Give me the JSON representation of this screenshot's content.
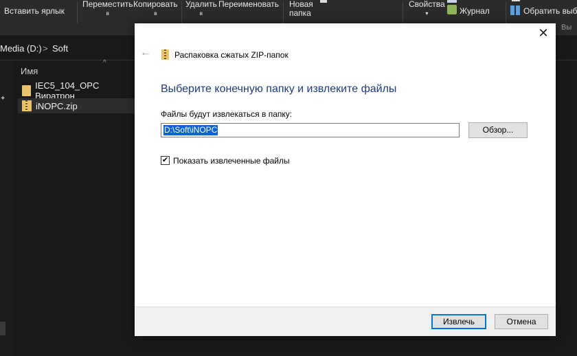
{
  "ribbon": {
    "paste_shortcut": "Вставить ярлык",
    "move_to": "Переместить",
    "copy_to": "Копировать",
    "caret": "в",
    "delete": "Удалить",
    "rename": "Переименовать",
    "new_folder_line1": "Новая",
    "new_folder_line2": "папка",
    "properties": "Свойства",
    "history": "Журнал",
    "select_all": "Обратить выбор",
    "cut_hint": "Вы"
  },
  "address": {
    "drive": "Media (D:)",
    "separator": ">",
    "folder": "Soft"
  },
  "files": {
    "column_name": "Имя",
    "items": [
      {
        "name": "IEC5_104_OPC Виратрон"
      },
      {
        "name": "iNOPC.zip"
      }
    ]
  },
  "dialog": {
    "title": "Распаковка сжатых ZIP-папок",
    "heading": "Выберите конечную папку и извлеките файлы",
    "label": "Файлы будут извлекаться в папку:",
    "path_value": "D:\\Soft\\iNOPC",
    "browse": "Обзор...",
    "show_files": "Показать извлеченные файлы",
    "show_files_checked": true,
    "extract": "Извлечь",
    "cancel": "Отмена"
  }
}
